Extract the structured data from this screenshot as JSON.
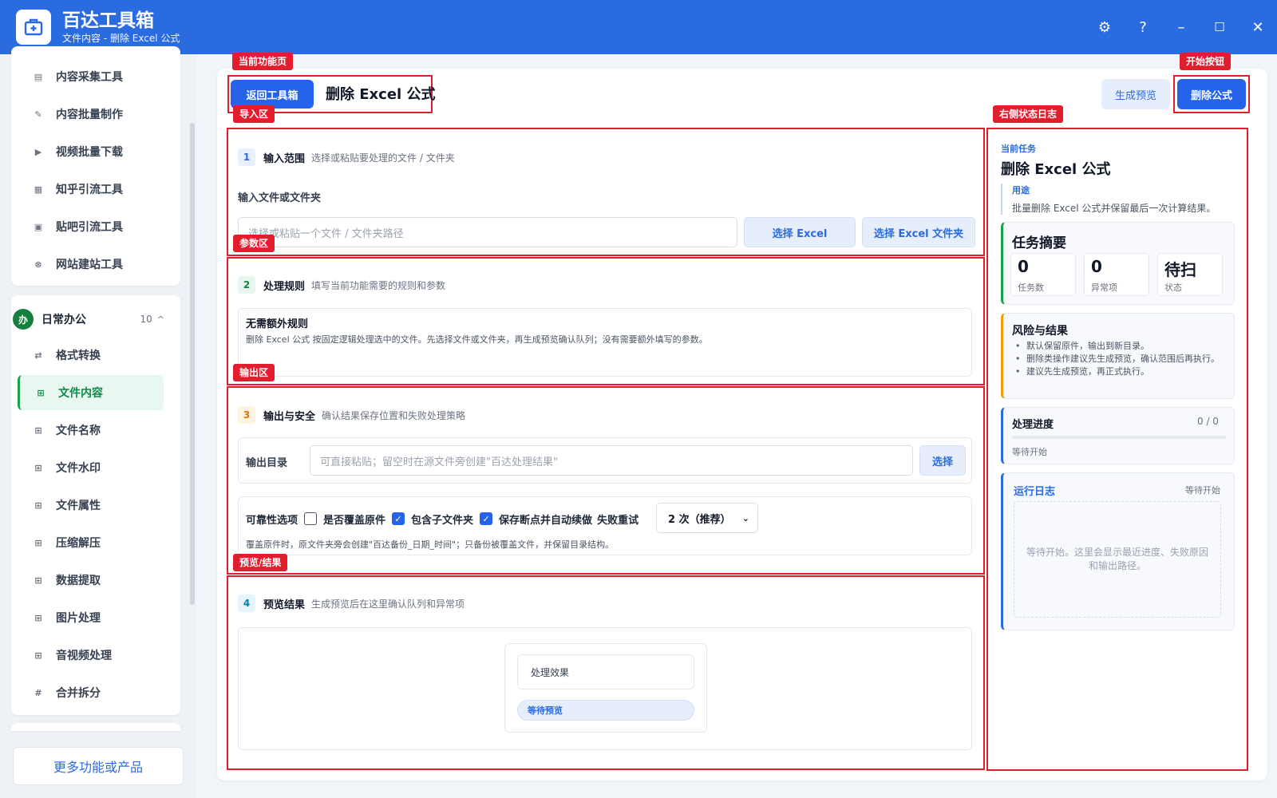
{
  "app": {
    "title": "百达工具箱",
    "subtitle": "文件内容 - 删除 Excel 公式",
    "controls": {
      "settings": "⚙",
      "help": "?",
      "minimize": "–",
      "maximize": "☐",
      "close": "✕"
    }
  },
  "sidebar": {
    "top_items": [
      {
        "label": "内容采集工具",
        "icon": "document-icon"
      },
      {
        "label": "内容批量制作",
        "icon": "pen-icon"
      },
      {
        "label": "视频批量下载",
        "icon": "video-icon"
      },
      {
        "label": "知乎引流工具",
        "icon": "zhihu-icon"
      },
      {
        "label": "贴吧引流工具",
        "icon": "tieba-icon"
      },
      {
        "label": "网站建站工具",
        "icon": "globe-icon"
      }
    ],
    "group": {
      "badge": "办",
      "name": "日常办公",
      "count": "10",
      "caret": "^"
    },
    "group_items": [
      {
        "label": "格式转换",
        "icon": "convert-icon"
      },
      {
        "label": "文件内容",
        "icon": "grid-icon",
        "active": true
      },
      {
        "label": "文件名称",
        "icon": "grid-icon"
      },
      {
        "label": "文件水印",
        "icon": "grid-icon"
      },
      {
        "label": "文件属性",
        "icon": "grid-icon"
      },
      {
        "label": "压缩解压",
        "icon": "grid-icon"
      },
      {
        "label": "数据提取",
        "icon": "grid-icon"
      },
      {
        "label": "图片处理",
        "icon": "grid-icon"
      },
      {
        "label": "音视频处理",
        "icon": "grid-icon"
      },
      {
        "label": "合并拆分",
        "icon": "hash-icon"
      }
    ],
    "more_button": "更多功能或产品"
  },
  "annotations": {
    "current_page": "当前功能页",
    "start_button": "开始按钮",
    "import_area": "导入区",
    "right_log": "右侧状态日志",
    "params_area": "参数区",
    "output_area": "输出区",
    "preview_area": "预览/结果"
  },
  "header": {
    "back_button": "返回工具箱",
    "page_title": "删除 Excel 公式",
    "preview_button": "生成预览",
    "start_button": "删除公式"
  },
  "section1": {
    "num": "1",
    "title": "输入范围",
    "desc": "选择或粘贴要处理的文件 / 文件夹",
    "field_label": "输入文件或文件夹",
    "placeholder": "选择或粘贴一个文件 / 文件夹路径",
    "btn_file": "选择 Excel",
    "btn_folder": "选择 Excel 文件夹"
  },
  "section2": {
    "num": "2",
    "title": "处理规则",
    "desc": "填写当前功能需要的规则和参数",
    "rule_title": "无需额外规则",
    "rule_desc": "删除 Excel 公式 按固定逻辑处理选中的文件。先选择文件或文件夹，再生成预览确认队列；没有需要额外填写的参数。"
  },
  "section3": {
    "num": "3",
    "title": "输出与安全",
    "desc": "确认结果保存位置和失败处理策略",
    "output_label": "输出目录",
    "output_placeholder": "可直接粘贴；留空时在源文件旁创建\"百达处理结果\"",
    "output_button": "选择",
    "reliability_label": "可靠性选项",
    "opt_overwrite": "是否覆盖原件",
    "opt_subfolders": "包含子文件夹",
    "opt_resume": "保存断点并自动续做",
    "retry_label": "失败重试",
    "retry_value": "2 次（推荐）",
    "note": "覆盖原件时，原文件夹旁会创建\"百达备份_日期_时间\"；只备份被覆盖文件，并保留目录结构。"
  },
  "section4": {
    "num": "4",
    "title": "预览结果",
    "desc": "生成预览后在这里确认队列和异常项",
    "effect_label": "处理效果",
    "status_pill": "等待预览"
  },
  "right_panel": {
    "task_label": "当前任务",
    "task_title": "删除 Excel 公式",
    "use_label": "用途",
    "use_text": "批量删除 Excel 公式并保留最后一次计算结果。",
    "summary_title": "任务摘要",
    "stats": [
      {
        "value": "0",
        "label": "任务数"
      },
      {
        "value": "0",
        "label": "异常项"
      },
      {
        "value": "待扫",
        "label": "状态"
      }
    ],
    "risk_title": "风险与结果",
    "risks": [
      "默认保留原件，输出到新目录。",
      "删除类操作建议先生成预览，确认范围后再执行。",
      "建议先生成预览，再正式执行。"
    ],
    "progress_title": "处理进度",
    "progress_value": "0 / 0",
    "progress_fraction": 0,
    "progress_status": "等待开始",
    "log_title": "运行日志",
    "log_status": "等待开始",
    "log_placeholder": "等待开始。这里会显示最近进度、失败原因和输出路径。"
  }
}
